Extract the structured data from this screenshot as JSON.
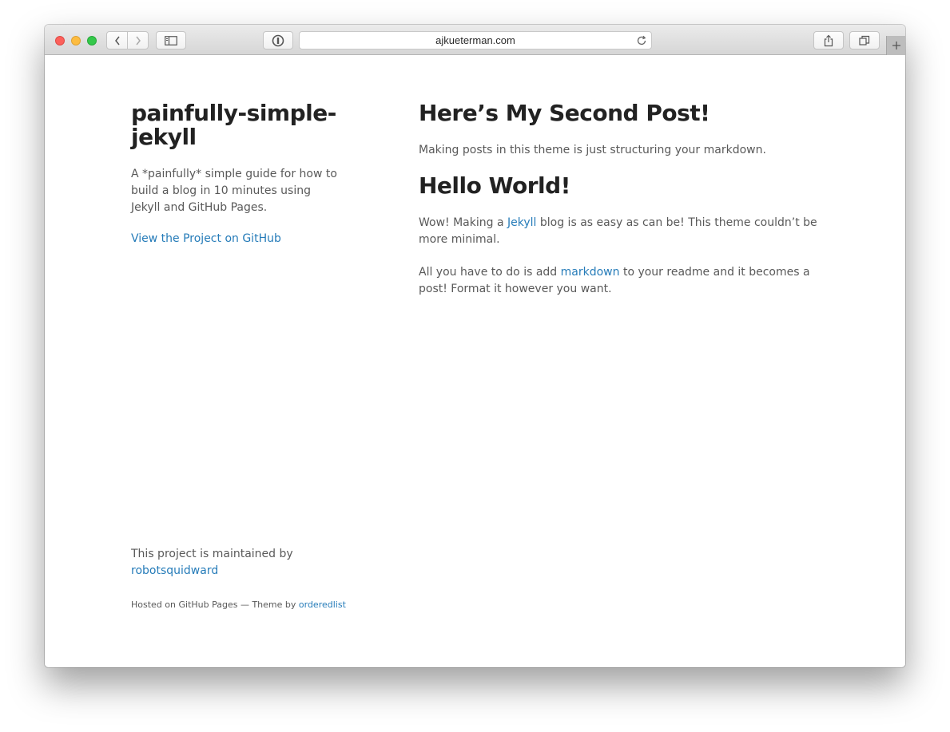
{
  "browser": {
    "url": "ajkueterman.com"
  },
  "sidebar": {
    "title": "painfully-simple-jekyll",
    "description": "A *painfully* simple guide for how to build a blog in 10 minutes using Jekyll and GitHub Pages.",
    "project_link": "View the Project on GitHub",
    "maintained_text": "This project is maintained by",
    "maintainer": "robotsquidward",
    "hosted_text": "Hosted on GitHub Pages — Theme by",
    "theme_author": "orderedlist"
  },
  "posts": [
    {
      "title": "Here’s My Second Post!",
      "paragraphs": [
        {
          "text": "Making posts in this theme is just structuring your markdown."
        }
      ]
    },
    {
      "title": "Hello World!",
      "paragraphs": [
        {
          "before": "Wow! Making a",
          "link": "Jekyll",
          "after": "blog is as easy as can be! This theme couldn’t be more minimal."
        },
        {
          "before": "All you have to do is add",
          "link": "markdown",
          "after": "to your readme and it becomes a post! Format it however you want."
        }
      ]
    }
  ],
  "colors": {
    "link": "#267CB9",
    "heading": "#222222",
    "text": "#595959"
  }
}
